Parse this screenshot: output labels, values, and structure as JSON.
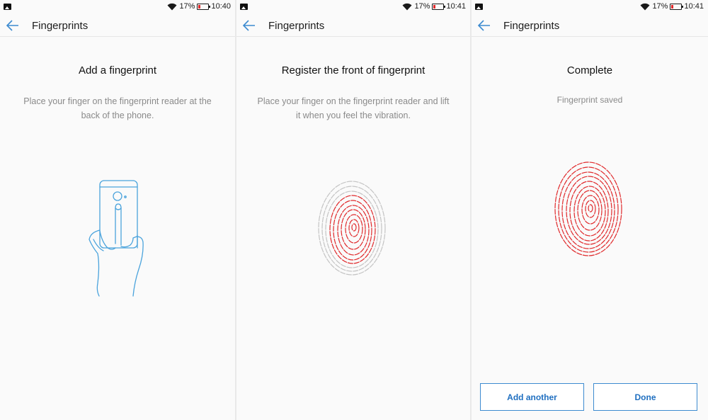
{
  "screens": [
    {
      "status": {
        "battery": "17%",
        "time": "10:40"
      },
      "title": "Fingerprints",
      "heading": "Add a fingerprint",
      "description": "Place your finger on the fingerprint reader at the back of the phone."
    },
    {
      "status": {
        "battery": "17%",
        "time": "10:41"
      },
      "title": "Fingerprints",
      "heading": "Register the front of fingerprint",
      "description": "Place your finger on the fingerprint reader and lift it when you feel the vibration."
    },
    {
      "status": {
        "battery": "17%",
        "time": "10:41"
      },
      "title": "Fingerprints",
      "heading": "Complete",
      "description": "Fingerprint saved",
      "buttons": {
        "add_another": "Add another",
        "done": "Done"
      }
    }
  ],
  "colors": {
    "accent": "#3d8bd0",
    "fingerprint_red": "#e0292b",
    "fingerprint_gray": "#c4c4c4",
    "illustration_blue": "#4aa3dc"
  },
  "icons": [
    "image-icon",
    "wifi-icon",
    "battery-icon",
    "back-arrow-icon",
    "phone-hand-illustration",
    "fingerprint-illustration"
  ]
}
